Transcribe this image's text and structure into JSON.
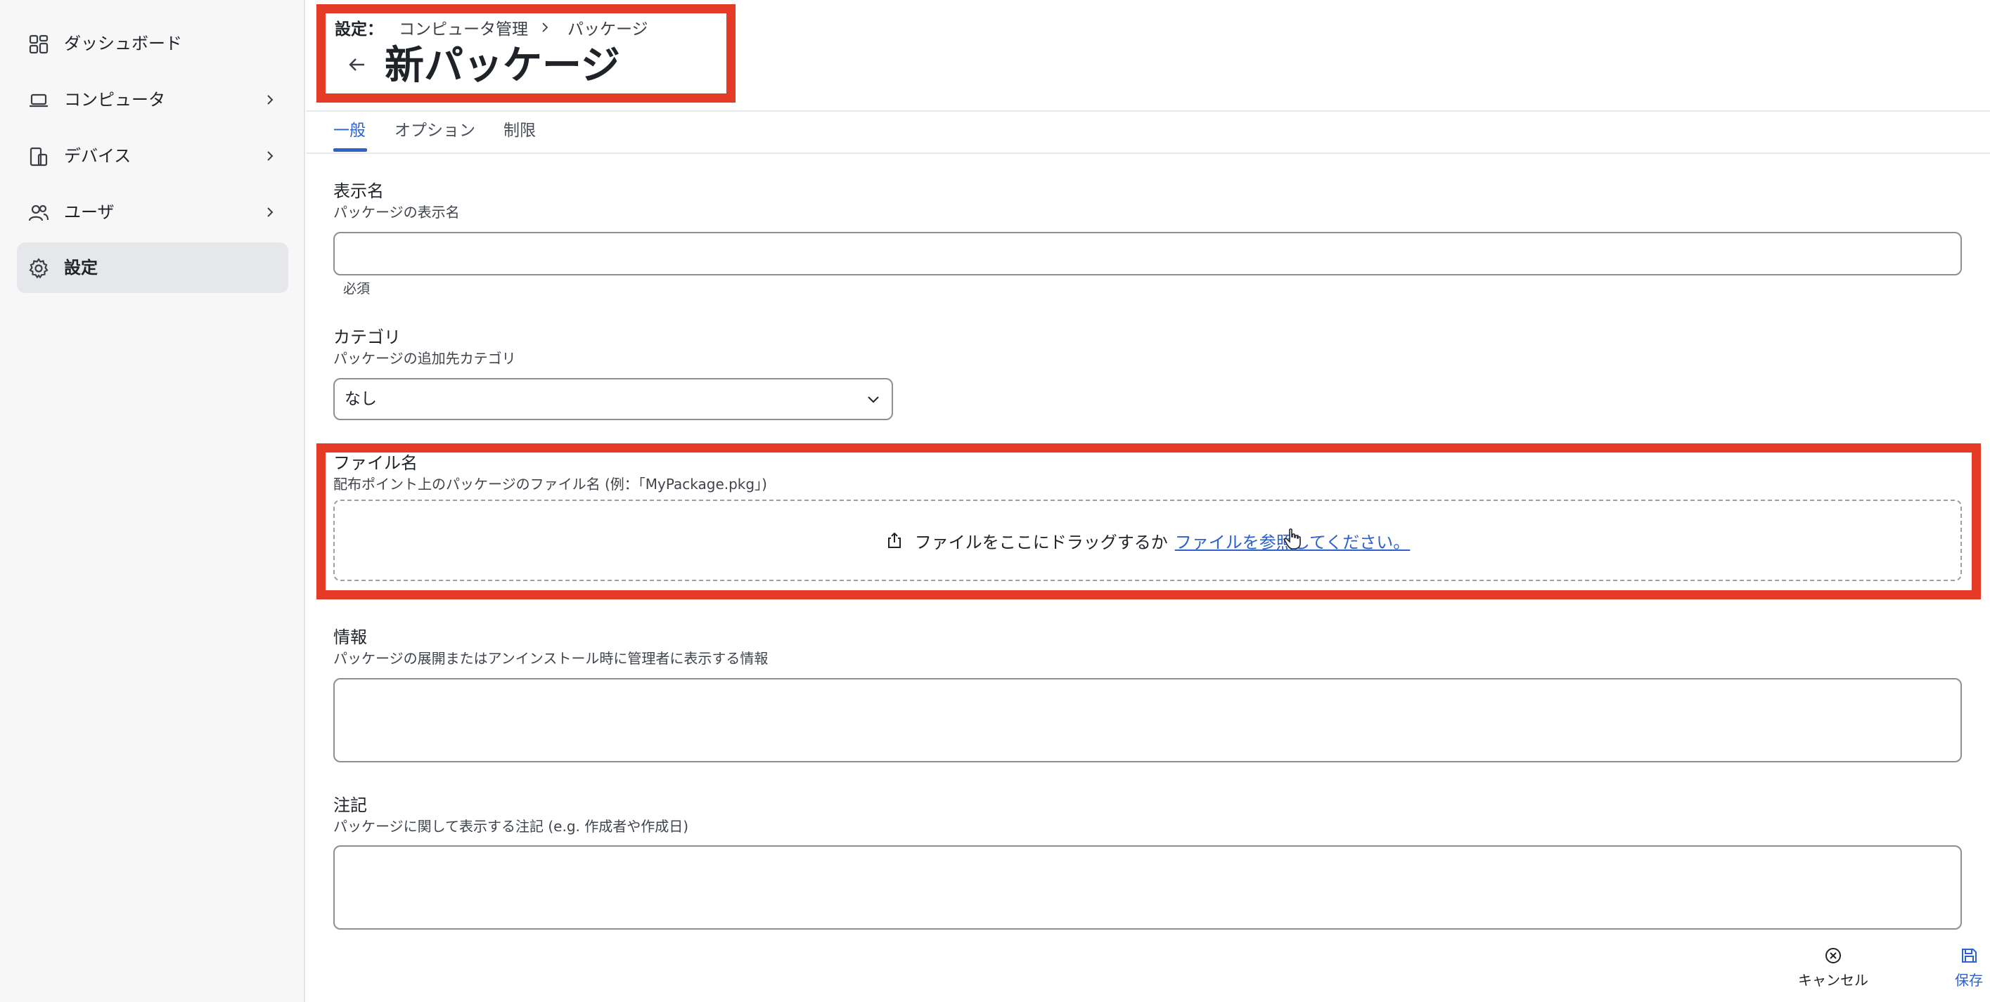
{
  "sidebar": {
    "items": [
      {
        "label": "ダッシュボード",
        "icon": "dashboard-icon"
      },
      {
        "label": "コンピュータ",
        "icon": "laptop-icon"
      },
      {
        "label": "デバイス",
        "icon": "devices-icon"
      },
      {
        "label": "ユーザ",
        "icon": "users-icon"
      },
      {
        "label": "設定",
        "icon": "gear-icon"
      }
    ],
    "active": "設定"
  },
  "header": {
    "breadcrumb": [
      "設定：",
      "コンピュータ管理",
      "パッケージ"
    ],
    "title": "新パッケージ"
  },
  "tabs": [
    {
      "label": "一般"
    },
    {
      "label": "オプション"
    },
    {
      "label": "制限"
    }
  ],
  "form": {
    "display_name": {
      "label": "表示名",
      "help": "パッケージの表示名",
      "value": "",
      "note": "必須"
    },
    "category": {
      "label": "カテゴリ",
      "help": "パッケージの追加先カテゴリ",
      "value": "なし"
    },
    "filename": {
      "label": "ファイル名",
      "help": "配布ポイント上のパッケージのファイル名 (例：「MyPackage.pkg」)",
      "drop_text": "ファイルをここにドラッグするか",
      "browse_text": "ファイルを参照してください。"
    },
    "info": {
      "label": "情報",
      "help": "パッケージの展開またはアンインストール時に管理者に表示する情報",
      "value": ""
    },
    "notes": {
      "label": "注記",
      "help": "パッケージに関して表示する注記 (e.g. 作成者や作成日)",
      "value": ""
    }
  },
  "footer": {
    "cancel_label": "キャンセル",
    "save_label": "保存"
  },
  "colors": {
    "accent": "#2e62c9",
    "highlight": "#e53a26"
  }
}
